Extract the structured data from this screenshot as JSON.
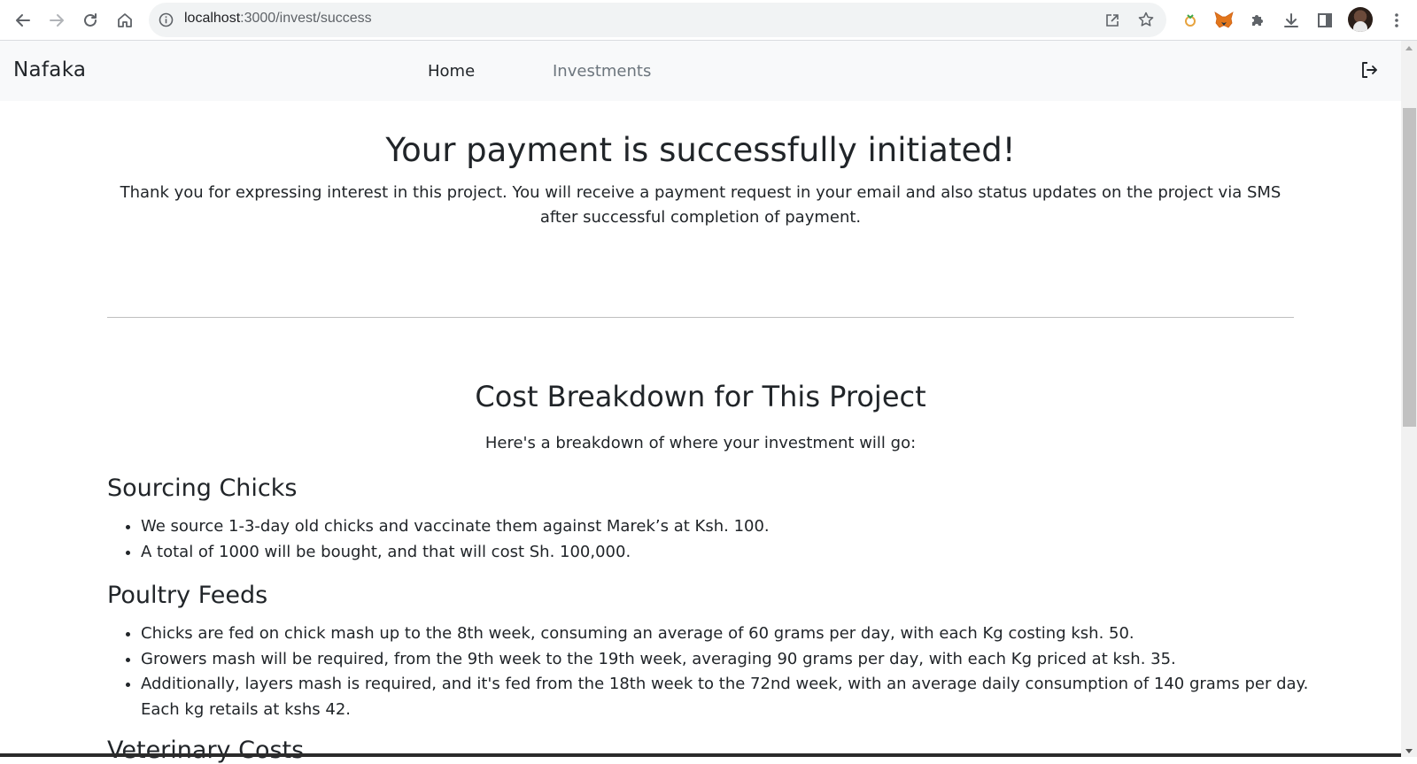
{
  "browser": {
    "url_host": "localhost",
    "url_path": ":3000/invest/success"
  },
  "navbar": {
    "brand": "Nafaka",
    "links": [
      {
        "label": "Home"
      },
      {
        "label": "Investments"
      }
    ]
  },
  "confirmation": {
    "title": "Your payment is successfully initiated!",
    "message": "Thank you for expressing interest in this project. You will receive a payment request in your email and also status updates on the project via SMS after successful completion of payment."
  },
  "breakdown": {
    "title": "Cost Breakdown for This Project",
    "subtitle": "Here's a breakdown of where your investment will go:",
    "categories": [
      {
        "heading": "Sourcing Chicks",
        "items": [
          "We source 1-3-day old chicks and vaccinate them against Marek’s at Ksh. 100.",
          "A total of 1000 will be bought, and that will cost Sh. 100,000."
        ]
      },
      {
        "heading": "Poultry Feeds",
        "items": [
          "Chicks are fed on chick mash up to the 8th week, consuming an average of 60 grams per day, with each Kg costing ksh. 50.",
          "Growers mash will be required, from the 9th week to the 19th week, averaging 90 grams per day, with each Kg priced at ksh. 35.",
          "Additionally, layers mash is required, and it's fed from the 18th week to the 72nd week, with an average daily consumption of 140 grams per day. Each kg retails at kshs 42."
        ]
      },
      {
        "heading": "Veterinary Costs",
        "items": []
      }
    ]
  },
  "icons": {
    "back": "arrow-left-icon",
    "forward": "arrow-right-icon",
    "reload": "reload-icon",
    "home": "home-icon",
    "site_info": "info-icon",
    "share": "share-icon",
    "bookmark": "star-icon",
    "extensions": "puzzle-icon",
    "download": "download-icon",
    "side_panel": "side-panel-icon",
    "menu": "kebab-menu-icon",
    "logout": "logout-icon"
  }
}
